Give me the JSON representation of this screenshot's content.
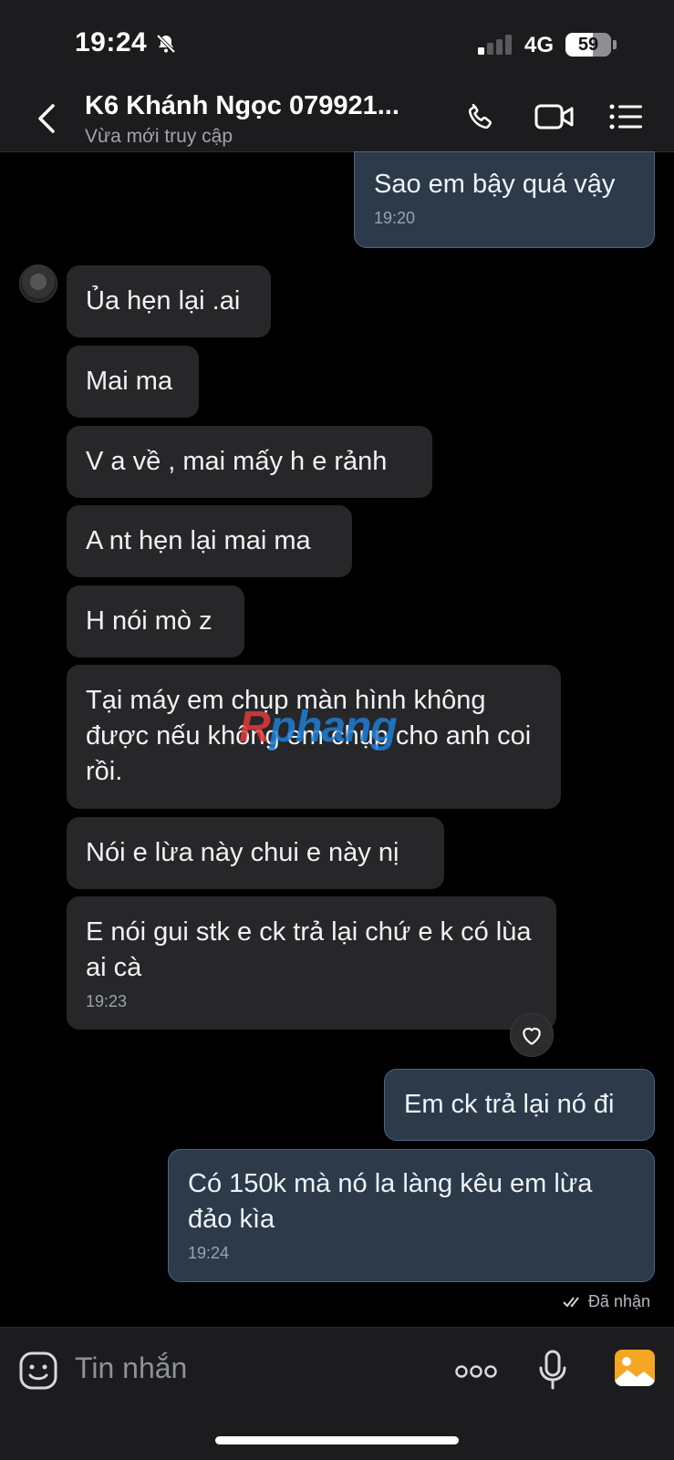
{
  "status_bar": {
    "time": "19:24",
    "network": "4G",
    "battery": "59",
    "battery_level": 0.59
  },
  "header": {
    "contact_name": "K6 Khánh Ngọc 079921...",
    "status": "Vừa mới truy cập"
  },
  "messages": [
    {
      "dir": "out",
      "text": "Sao em bậy quá vậy",
      "time": "19:20"
    },
    {
      "dir": "in",
      "text": "Ủa hẹn lại .ai"
    },
    {
      "dir": "in",
      "text": "Mai ma"
    },
    {
      "dir": "in",
      "text": "V a về , mai mấy h e rảnh"
    },
    {
      "dir": "in",
      "text": "A nt hẹn lại mai ma"
    },
    {
      "dir": "in",
      "text": "H nói mò z"
    },
    {
      "dir": "in",
      "text": "Tại máy em chụp màn hình không được nếu không em chụp cho anh coi rồi."
    },
    {
      "dir": "in",
      "text": "Nói e lừa này chui e này nị"
    },
    {
      "dir": "in",
      "text": "E nói gui stk e ck trả lại chứ e k có lùa ai cà",
      "time": "19:23"
    },
    {
      "dir": "out",
      "text": "Em ck trả lại nó đi"
    },
    {
      "dir": "out",
      "text": "Có 150k mà nó la làng kêu em lừa đảo kìa",
      "time": "19:24"
    }
  ],
  "read_receipt": "Đã nhận",
  "watermark": {
    "part1": "R",
    "part2": "phang"
  },
  "composer": {
    "placeholder": "Tin nhắn"
  },
  "colors": {
    "accent_photo": "#f5a623",
    "bubble_in": "#27272a",
    "bubble_out": "#2c3a4a",
    "background": "#000000"
  }
}
